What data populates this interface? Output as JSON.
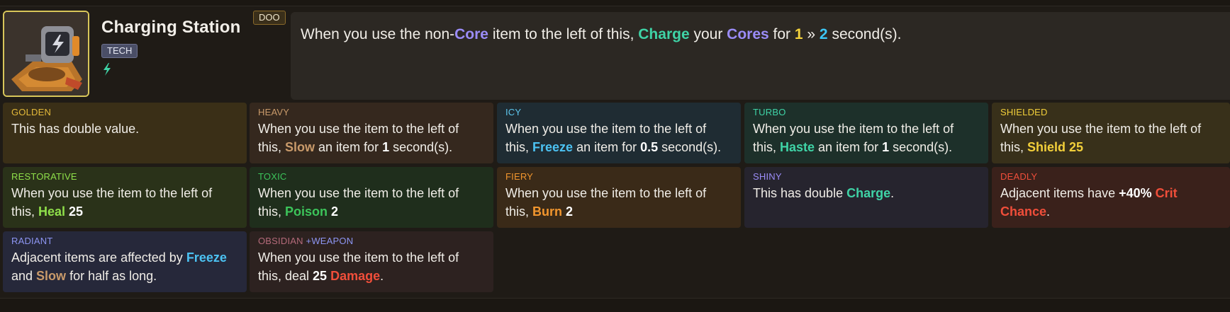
{
  "item": {
    "name": "Charging Station",
    "tag": "TECH",
    "tier": "DOO",
    "icon": "lightning-bolt-icon",
    "description": {
      "p1": "When you use the non-",
      "core": "Core",
      "p2": " item to the left of this, ",
      "charge": "Charge",
      "p3": " your ",
      "cores": "Cores",
      "p4": " for ",
      "v1": "1",
      "arrow": " » ",
      "v2": "2",
      "p5": " second(s)."
    }
  },
  "enchantments": {
    "golden": {
      "name": "GOLDEN",
      "text": "This has double value."
    },
    "heavy": {
      "name": "HEAVY",
      "t1": "When you use the item to the left of this, ",
      "kw": "Slow",
      "t2": " an item for ",
      "val": "1",
      "t3": " second(s)."
    },
    "icy": {
      "name": "ICY",
      "t1": "When you use the item to the left of this, ",
      "kw": "Freeze",
      "t2": " an item for ",
      "val": "0.5",
      "t3": " second(s)."
    },
    "turbo": {
      "name": "TURBO",
      "t1": "When you use the item to the left of this, ",
      "kw": "Haste",
      "t2": " an item for ",
      "val": "1",
      "t3": " second(s)."
    },
    "shielded": {
      "name": "SHIELDED",
      "t1": "When you use the item to the left of this, ",
      "kw": "Shield",
      "val": " 25"
    },
    "restorative": {
      "name": "RESTORATIVE",
      "t1": "When you use the item to the left of this, ",
      "kw": "Heal",
      "val": " 25"
    },
    "toxic": {
      "name": "TOXIC",
      "t1": "When you use the item to the left of this, ",
      "kw": "Poison",
      "val": " 2"
    },
    "fiery": {
      "name": "FIERY",
      "t1": "When you use the item to the left of this, ",
      "kw": "Burn",
      "val": " 2"
    },
    "shiny": {
      "name": "SHINY",
      "t1": "This has double ",
      "kw": "Charge",
      "t2": "."
    },
    "deadly": {
      "name": "DEADLY",
      "t1": "Adjacent items have ",
      "val": "+40%",
      "kw": " Crit Chance",
      "t2": "."
    },
    "radiant": {
      "name": "RADIANT",
      "t1": "Adjacent items are affected by ",
      "kw1": "Freeze",
      "t2": " and ",
      "kw2": "Slow",
      "t3": " for half as long."
    },
    "obsidian": {
      "name": "OBSIDIAN",
      "extra": "+WEAPON",
      "t1": "When you use the item to the left of this, deal ",
      "val": "25",
      "kw": " Damage",
      "t2": "."
    }
  },
  "colors": {
    "core": "#9b8cf7",
    "charge": "#3fd3a6",
    "freeze": "#4cc2f2",
    "slow": "#c99a6a",
    "shield": "#f2cf3a",
    "heal": "#8fe04a",
    "poison": "#3cc45a",
    "burn": "#f2962e",
    "damage": "#f04e3a",
    "frame": "#d8c65a"
  }
}
